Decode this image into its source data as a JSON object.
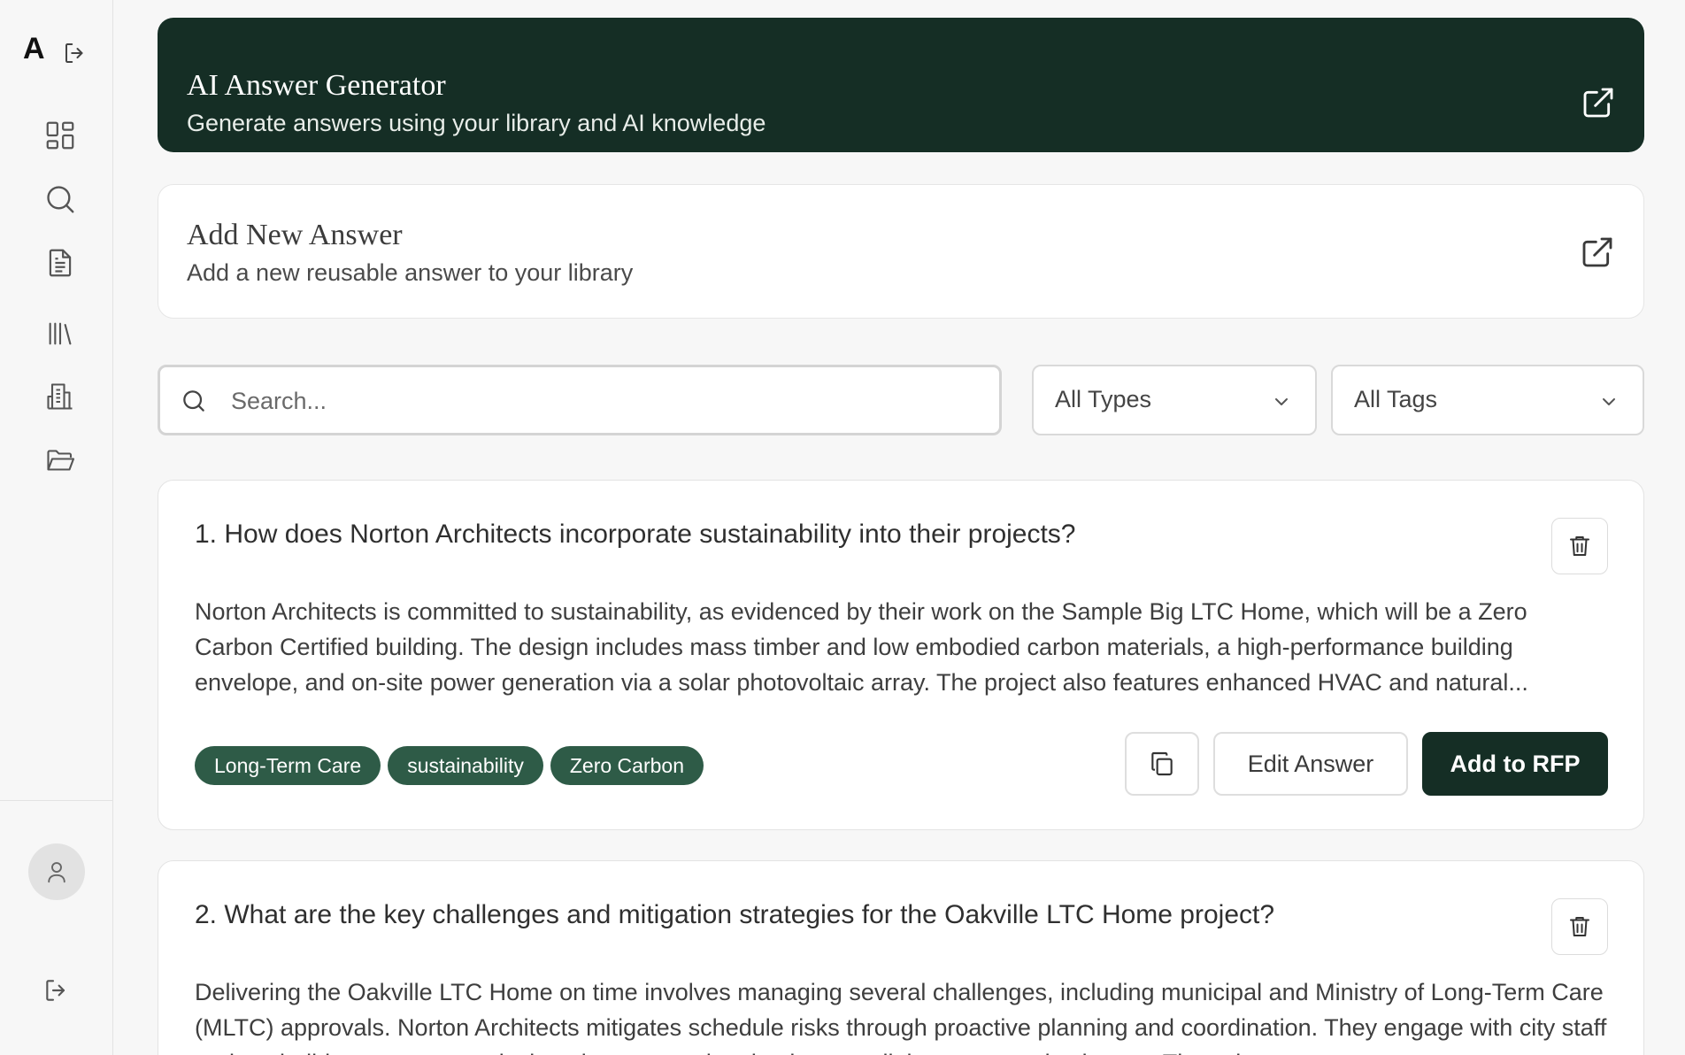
{
  "sidebar": {
    "brand": "A",
    "nav": [
      {
        "icon": "dashboard-icon"
      },
      {
        "icon": "search-icon"
      },
      {
        "icon": "document-icon"
      },
      {
        "icon": "library-icon"
      },
      {
        "icon": "building-icon"
      },
      {
        "icon": "folder-icon"
      }
    ]
  },
  "generator": {
    "title": "AI Answer Generator",
    "subtitle": "Generate answers using your library and AI knowledge"
  },
  "add_answer": {
    "title": "Add New Answer",
    "subtitle": "Add a new reusable answer to your library"
  },
  "filters": {
    "search_placeholder": "Search...",
    "type_value": "All Types",
    "tag_value": "All Tags"
  },
  "answers": [
    {
      "question": "1. How does Norton Architects incorporate sustainability into their projects?",
      "body": "Norton Architects is committed to sustainability, as evidenced by their work on the Sample Big LTC Home, which will be a Zero Carbon Certified building. The design includes mass timber and low embodied carbon materials, a high-performance building envelope, and on-site power generation via a solar photovoltaic array. The project also features enhanced HVAC and natural...",
      "tags": [
        "Long-Term Care",
        "sustainability",
        "Zero Carbon"
      ],
      "edit_label": "Edit Answer",
      "add_label": "Add to RFP"
    },
    {
      "question": "2. What are the key challenges and mitigation strategies for the Oakville LTC Home project?",
      "body": "Delivering the Oakville LTC Home on time involves managing several challenges, including municipal and Ministry of Long-Term Care (MLTC) approvals. Norton Architects mitigates schedule risks through proactive planning and coordination. They engage with city staff early to build consensus on design elements and maintain open dialogue to resolve issues. They also prepare"
    }
  ]
}
